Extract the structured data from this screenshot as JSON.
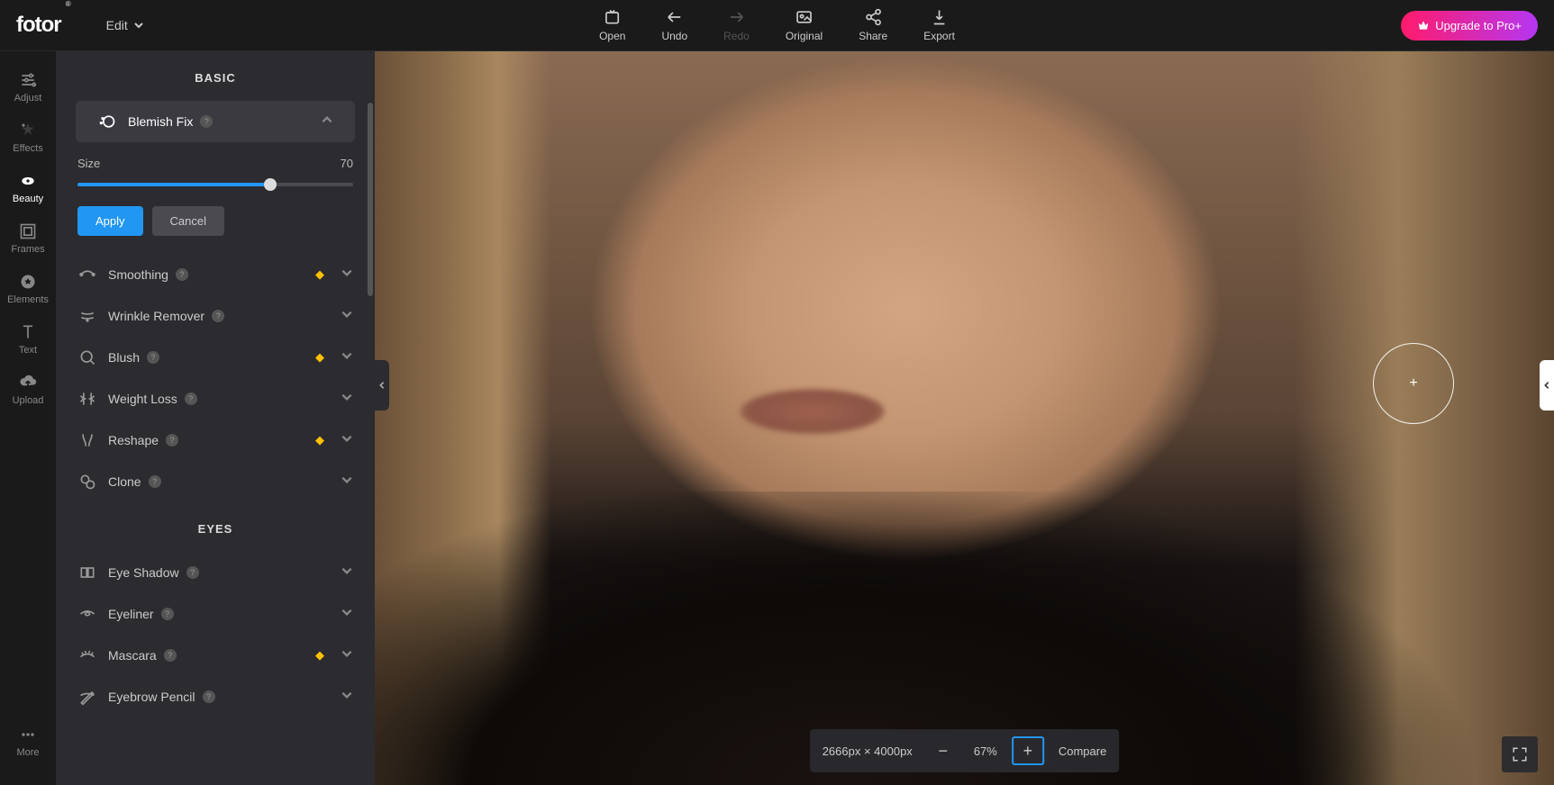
{
  "header": {
    "logo": "fotor",
    "edit_menu": "Edit",
    "upgrade_btn": "Upgrade to Pro+",
    "actions": [
      {
        "label": "Open"
      },
      {
        "label": "Undo"
      },
      {
        "label": "Redo"
      },
      {
        "label": "Original"
      },
      {
        "label": "Share"
      },
      {
        "label": "Export"
      }
    ]
  },
  "nav": {
    "items": [
      {
        "label": "Adjust"
      },
      {
        "label": "Effects"
      },
      {
        "label": "Beauty"
      },
      {
        "label": "Frames"
      },
      {
        "label": "Elements"
      },
      {
        "label": "Text"
      },
      {
        "label": "Upload"
      }
    ],
    "more": "More"
  },
  "panel": {
    "section_basic": "BASIC",
    "section_eyes": "EYES",
    "blemish": {
      "label": "Blemish Fix"
    },
    "size_label": "Size",
    "size_value": "70",
    "apply": "Apply",
    "cancel": "Cancel",
    "tools_basic": [
      {
        "label": "Smoothing",
        "premium": true
      },
      {
        "label": "Wrinkle Remover",
        "premium": false
      },
      {
        "label": "Blush",
        "premium": true
      },
      {
        "label": "Weight Loss",
        "premium": false
      },
      {
        "label": "Reshape",
        "premium": true
      },
      {
        "label": "Clone",
        "premium": false
      }
    ],
    "tools_eyes": [
      {
        "label": "Eye Shadow",
        "premium": false
      },
      {
        "label": "Eyeliner",
        "premium": false
      },
      {
        "label": "Mascara",
        "premium": true
      },
      {
        "label": "Eyebrow Pencil",
        "premium": false
      }
    ]
  },
  "bottombar": {
    "dimensions": "2666px × 4000px",
    "zoom": "67%",
    "compare": "Compare"
  }
}
